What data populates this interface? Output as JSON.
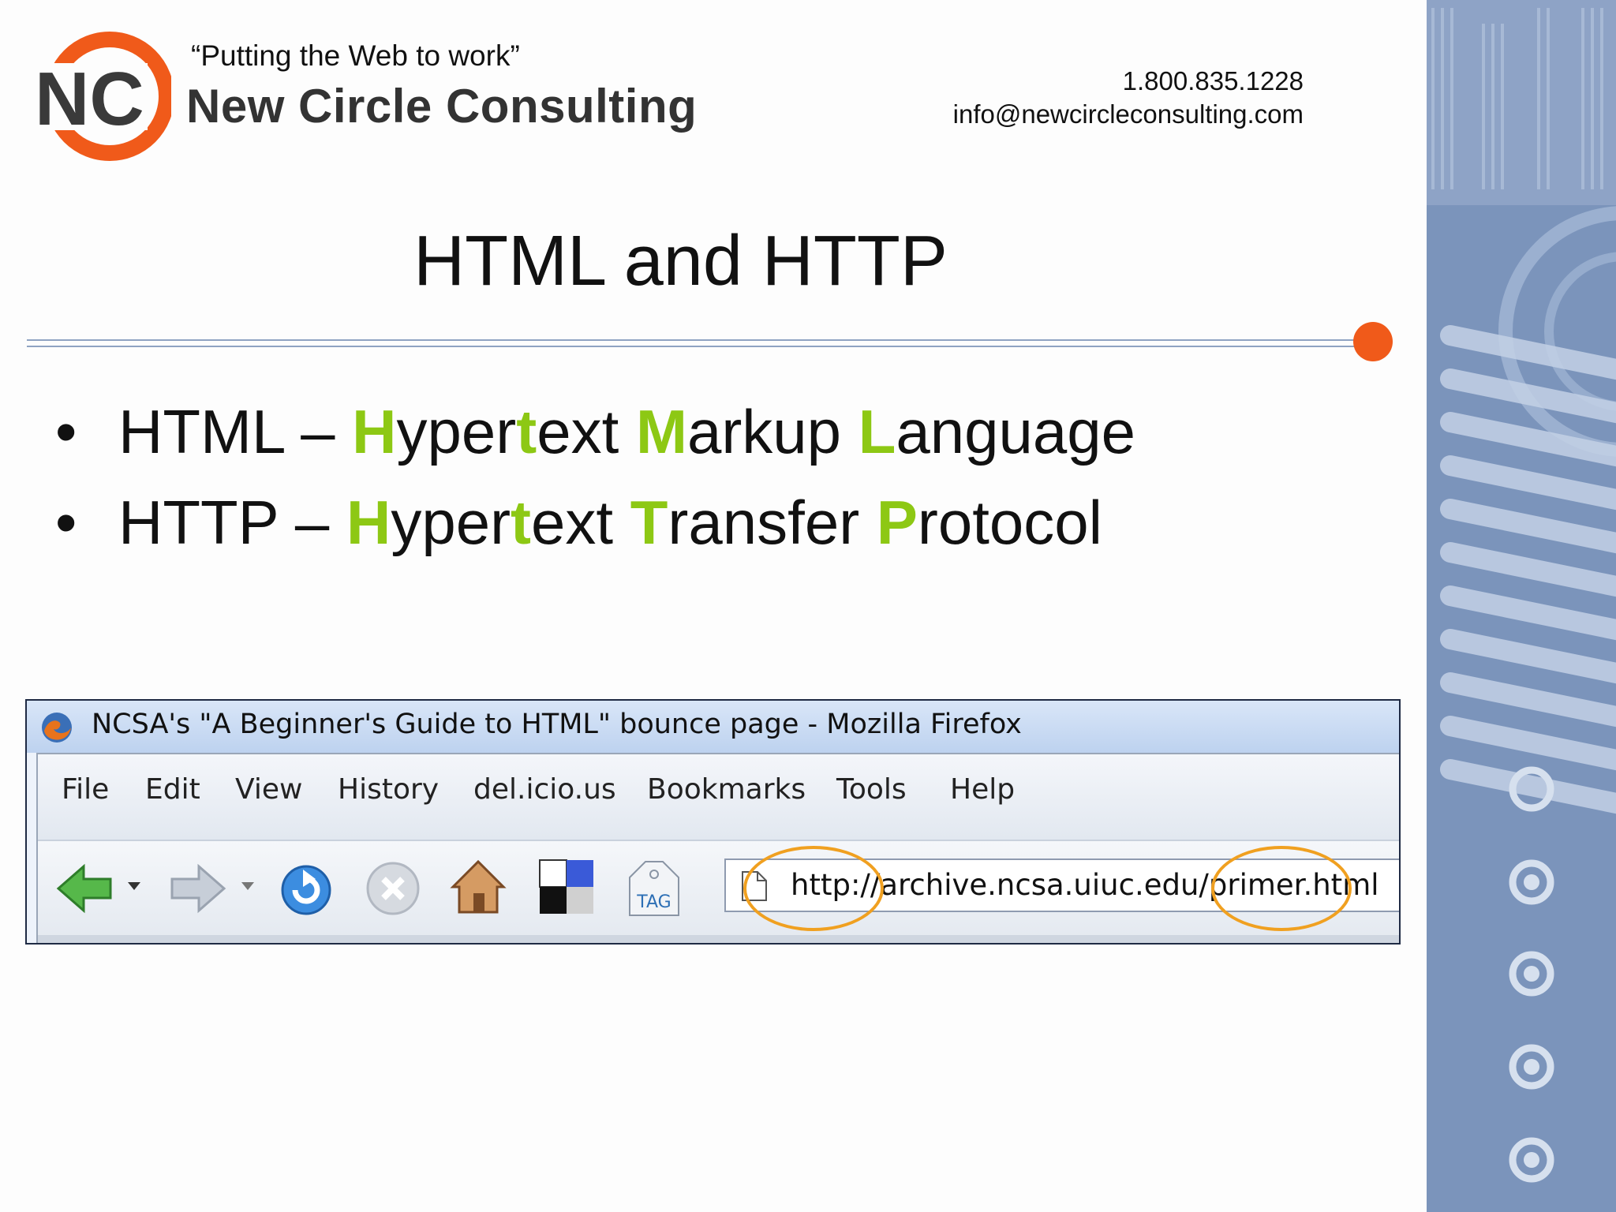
{
  "header": {
    "tagline": "“Putting the Web to work”",
    "company": "New Circle Consulting",
    "logo_mark": "NC",
    "phone": "1.800.835.1228",
    "email": "info@newcircleconsulting.com"
  },
  "slide": {
    "title": "HTML and HTTP",
    "bullets": [
      {
        "bullet": "•",
        "parts": [
          {
            "text": "HTML – ",
            "highlight": false
          },
          {
            "text": "H",
            "highlight": true
          },
          {
            "text": "yper",
            "highlight": false
          },
          {
            "text": "t",
            "highlight": true
          },
          {
            "text": "ext ",
            "highlight": false
          },
          {
            "text": "M",
            "highlight": true
          },
          {
            "text": "arkup ",
            "highlight": false
          },
          {
            "text": "L",
            "highlight": true
          },
          {
            "text": "anguage",
            "highlight": false
          }
        ]
      },
      {
        "bullet": "•",
        "parts": [
          {
            "text": "HTTP – ",
            "highlight": false
          },
          {
            "text": "H",
            "highlight": true
          },
          {
            "text": "yper",
            "highlight": false
          },
          {
            "text": "t",
            "highlight": true
          },
          {
            "text": "ext ",
            "highlight": false
          },
          {
            "text": "T",
            "highlight": true
          },
          {
            "text": "ransfer ",
            "highlight": false
          },
          {
            "text": "P",
            "highlight": true
          },
          {
            "text": "rotocol",
            "highlight": false
          }
        ]
      }
    ]
  },
  "browser": {
    "window_title": "NCSA's \"A Beginner's Guide to HTML\" bounce page - Mozilla Firefox",
    "menu": [
      "File",
      "Edit",
      "View",
      "History",
      "del.icio.us",
      "Bookmarks",
      "Tools",
      "Help"
    ],
    "url": "http://archive.ncsa.uiuc.edu/primer.html",
    "tag_label": "TAG",
    "toolbar_icons": [
      "back-arrow-icon",
      "dropdown-icon",
      "forward-arrow-icon",
      "dropdown-icon",
      "reload-icon",
      "stop-icon",
      "home-icon",
      "delicious-icon",
      "tag-icon"
    ]
  },
  "colors": {
    "highlight": "#8dc814",
    "accent_orange": "#f05a1a",
    "annotation_circle": "#f0a020",
    "side_panel": "#7b94bb"
  }
}
